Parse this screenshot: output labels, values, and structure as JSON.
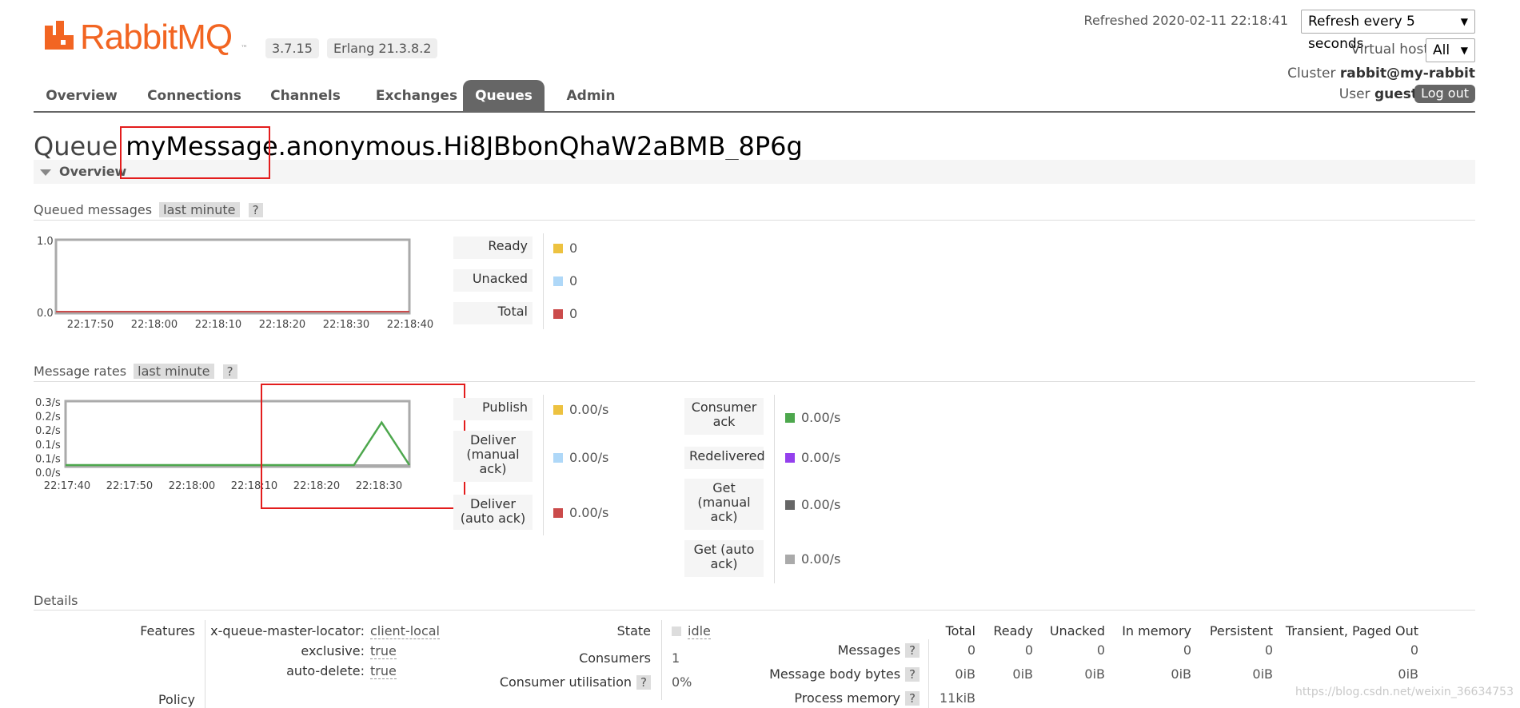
{
  "header": {
    "logo_text": "RabbitMQ",
    "rabbitmq_version": "3.7.15",
    "erlang_version": "Erlang 21.3.8.2",
    "refreshed_label": "Refreshed",
    "refreshed_time": "2020-02-11 22:18:41",
    "refresh_select": "Refresh every 5 seconds",
    "virtual_host_label": "Virtual host",
    "virtual_host_value": "All",
    "cluster_label": "Cluster",
    "cluster_value": "rabbit@my-rabbit",
    "user_label": "User",
    "user_value": "guest",
    "logout_label": "Log out",
    "brand_color": "#f26522"
  },
  "nav": {
    "tabs": [
      {
        "label": "Overview",
        "active": false
      },
      {
        "label": "Connections",
        "active": false
      },
      {
        "label": "Channels",
        "active": false
      },
      {
        "label": "Exchanges",
        "active": false
      },
      {
        "label": "Queues",
        "active": true
      },
      {
        "label": "Admin",
        "active": false
      }
    ]
  },
  "page": {
    "title_prefix": "Queue",
    "queue_name": "myMessage.anonymous.Hi8JBbonQhaW2aBMB_8P6g",
    "overview_label": "Overview"
  },
  "queued_messages": {
    "heading": "Queued messages",
    "range": "last minute",
    "help": "?",
    "legend": [
      {
        "label": "Ready",
        "value": "0",
        "color": "#edc240"
      },
      {
        "label": "Unacked",
        "value": "0",
        "color": "#afd8f8"
      },
      {
        "label": "Total",
        "value": "0",
        "color": "#cb4b4b"
      }
    ]
  },
  "message_rates": {
    "heading": "Message rates",
    "range": "last minute",
    "help": "?",
    "legend_left": [
      {
        "label": "Publish",
        "value": "0.00/s",
        "color": "#edc240"
      },
      {
        "label": "Deliver (manual ack)",
        "value": "0.00/s",
        "color": "#afd8f8"
      },
      {
        "label": "Deliver (auto ack)",
        "value": "0.00/s",
        "color": "#cb4b4b"
      }
    ],
    "legend_right": [
      {
        "label": "Consumer ack",
        "value": "0.00/s",
        "color": "#4da74d"
      },
      {
        "label": "Redelivered",
        "value": "0.00/s",
        "color": "#9440ed"
      },
      {
        "label": "Get (manual ack)",
        "value": "0.00/s",
        "color": "#666666"
      },
      {
        "label": "Get (auto ack)",
        "value": "0.00/s",
        "color": "#aaaaaa"
      }
    ]
  },
  "chart_data": [
    {
      "type": "line",
      "name": "queued-messages",
      "x": [
        "22:17:50",
        "22:18:00",
        "22:18:10",
        "22:18:20",
        "22:18:30",
        "22:18:40"
      ],
      "ylim": [
        0,
        1.0
      ],
      "yticks": [
        "1.0",
        "0.0"
      ],
      "series": [
        {
          "name": "Total",
          "color": "#cb4b4b",
          "values": [
            0,
            0,
            0,
            0,
            0,
            0
          ]
        }
      ]
    },
    {
      "type": "line",
      "name": "message-rates",
      "x": [
        "22:17:40",
        "22:17:50",
        "22:18:00",
        "22:18:10",
        "22:18:20",
        "22:18:30"
      ],
      "ylim": [
        0,
        0.3
      ],
      "yticks": [
        "0.3/s",
        "0.2/s",
        "0.2/s",
        "0.1/s",
        "0.1/s",
        "0.0/s"
      ],
      "series": [
        {
          "name": "Consumer ack",
          "color": "#4da74d",
          "points": [
            [
              0,
              0
            ],
            [
              52,
              0
            ],
            [
              57,
              0.2
            ],
            [
              62,
              0
            ]
          ]
        }
      ]
    }
  ],
  "details": {
    "heading": "Details",
    "features_label": "Features",
    "features": [
      {
        "key": "x-queue-master-locator:",
        "value": "client-local"
      },
      {
        "key": "exclusive:",
        "value": "true"
      },
      {
        "key": "auto-delete:",
        "value": "true"
      }
    ],
    "policy_label": "Policy",
    "state_label": "State",
    "state_value": "idle",
    "consumers_label": "Consumers",
    "consumers_value": "1",
    "consumer_util_label": "Consumer utilisation",
    "consumer_util_value": "0%",
    "table": {
      "headers": [
        "Total",
        "Ready",
        "Unacked",
        "In memory",
        "Persistent",
        "Transient, Paged Out"
      ],
      "rows": [
        {
          "label": "Messages",
          "values": [
            "0",
            "0",
            "0",
            "0",
            "0",
            "0"
          ]
        },
        {
          "label": "Message body bytes",
          "values": [
            "0iB",
            "0iB",
            "0iB",
            "0iB",
            "0iB",
            "0iB"
          ]
        },
        {
          "label": "Process memory",
          "values": [
            "11kiB"
          ]
        }
      ]
    }
  },
  "watermark": "https://blog.csdn.net/weixin_36634753"
}
